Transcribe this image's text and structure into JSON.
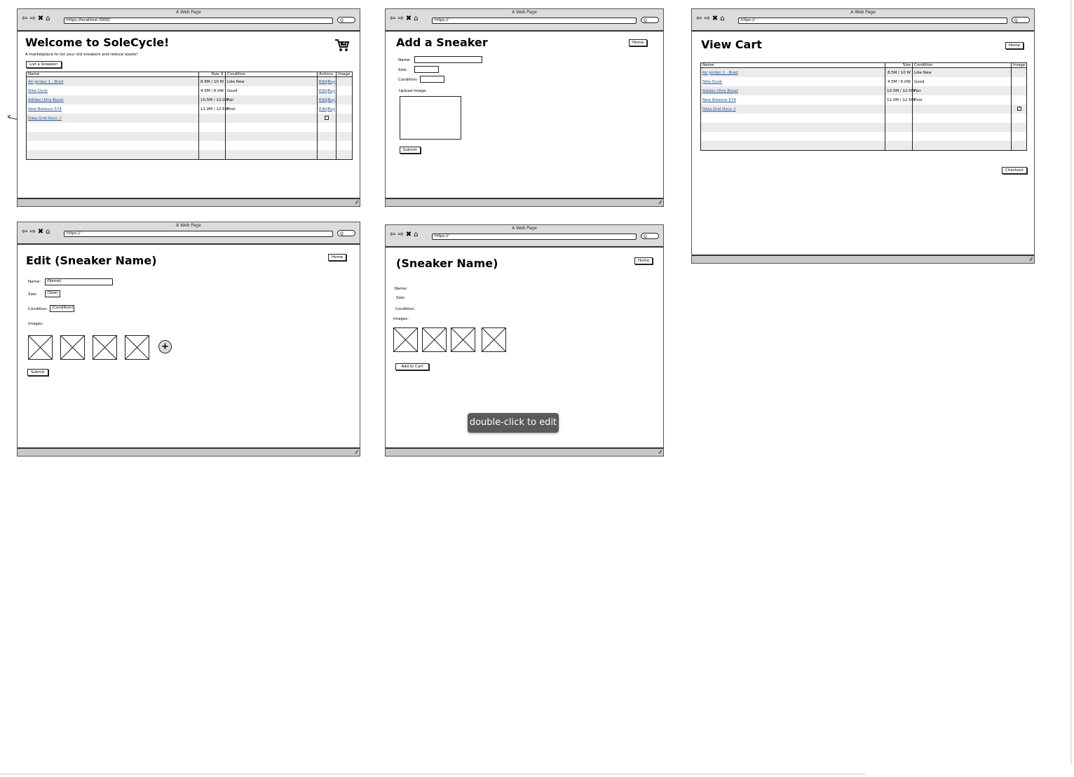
{
  "common": {
    "window_title": "A Web Page",
    "search_glyph": "Q",
    "grip": "⁄⁄",
    "home_label": "Home",
    "submit_label": "Submit"
  },
  "home": {
    "url": "https://localhost:3000/",
    "title": "Welcome to SoleCycle!",
    "subtitle": "A marketplace to list your old sneakers and reduce waste!",
    "list_button": "List a Sneaker!",
    "columns": [
      "Name",
      "Size ⇕",
      "Condition",
      "Actions",
      "Image"
    ],
    "rows": [
      {
        "name": "Air Jordan 1 - Bred",
        "size": "8.5M / 10 W",
        "condition": "Like New",
        "edit": "Edit",
        "sep": "|",
        "buy": "Buy"
      },
      {
        "name": "Nike Dunk",
        "size": "4.5M / 6.0W",
        "condition": "Good",
        "edit": "Edit",
        "sep": "|",
        "buy": "Buy"
      },
      {
        "name": "Adidas Ultra Boost",
        "size": "10.5M / 12.0W",
        "condition": "Fair",
        "edit": "Edit",
        "sep": "|",
        "buy": "Buy"
      },
      {
        "name": "New Balance 574",
        "size": "11.0M / 12.5W",
        "condition": "Poor",
        "edit": "Edit",
        "sep": "|",
        "buy": "Buy"
      },
      {
        "name": "Data Grid Docs",
        "size": "",
        "condition": "",
        "edit": "",
        "sep": "",
        "buy": ""
      }
    ]
  },
  "add": {
    "url": "https://",
    "title": "Add a Sneaker",
    "name_label": "Name:",
    "size_label": "Size:",
    "condition_label": "Condition:",
    "upload_label": "Upload Image:"
  },
  "cart": {
    "url": "https://",
    "title": "View Cart",
    "columns": [
      "Name",
      "Size",
      "Condition",
      "Image"
    ],
    "rows": [
      {
        "name": "Air Jordan 1 - Bred",
        "size": "8.5M / 10 W",
        "condition": "Like New"
      },
      {
        "name": "Nike Dunk",
        "size": "4.5M / 6.0W",
        "condition": "Good"
      },
      {
        "name": "Adidas Ultra Boost",
        "size": "10.5M / 12.0W",
        "condition": "Fair"
      },
      {
        "name": "New Balance 574",
        "size": "11.0M / 12.5W",
        "condition": "Poor"
      },
      {
        "name": "Data Grid Docs",
        "size": "",
        "condition": ""
      }
    ],
    "checkout_label": "Checkout"
  },
  "edit": {
    "url": "https://",
    "title": "Edit (Sneaker Name)",
    "name_label": "Name:",
    "name_value": "(Name)",
    "size_label": "Size:",
    "size_value": "(Size)",
    "condition_label": "Condition:",
    "condition_value": "(Condition)",
    "images_label": "Images:",
    "add_icon": "+"
  },
  "detail": {
    "url": "https://",
    "title": "(Sneaker Name)",
    "name_label": "Name:",
    "size_label": "Size:",
    "condition_label": "Condition:",
    "images_label": "Images:",
    "add_to_cart_label": "Add to Cart"
  },
  "tooltip": "double-click to edit",
  "colors": {
    "link": "#1f4f99",
    "tooltip_bg": "#5a5a5a",
    "chrome": "#dcdcdc"
  }
}
